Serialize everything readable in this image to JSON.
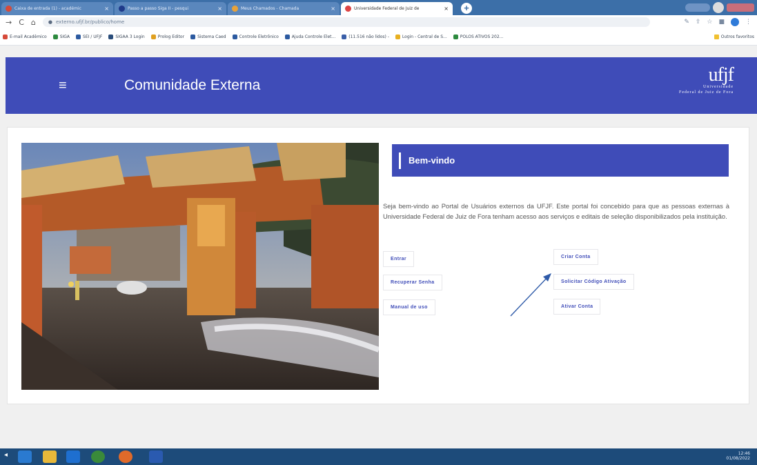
{
  "browser": {
    "tabs": [
      {
        "label": "Caixa de entrada (1) - académic"
      },
      {
        "label": "Passo a passo Siga II - pesqui"
      },
      {
        "label": "Meus Chamados - Chamada"
      },
      {
        "label": "Universidade Federal de Juiz de"
      }
    ],
    "url": "externo.ufjf.br/publico/home",
    "bookmarks": [
      "E-mail Acadêmico",
      "SIGA",
      "SEI / UFJF",
      "SIGAA 3 Login",
      "Prolog Editor",
      "Sistema Caed",
      "Controle Eletrônico",
      "Ajuda Controle Elet...",
      "(11.516 não lidos) -",
      "Login - Central de S...",
      "POLOS ATIVOS 202..."
    ],
    "bookmarks_other": "Outros favoritos"
  },
  "header": {
    "menu_icon": "≡",
    "title": "Comunidade Externa",
    "logo_mark": "ufjf",
    "logo_sub1": "Universidade",
    "logo_sub2": "Federal de Juiz de Fora"
  },
  "welcome": {
    "heading": "Bem-vindo",
    "body": "Seja bem-vindo ao Portal de Usuários externos da UFJF. Este portal foi concebido para que as pessoas externas à Universidade Federal de Juiz de Fora tenham acesso aos serviços e editais de seleção disponibilizados pela instituição."
  },
  "actions": {
    "entrar": "Entrar",
    "criar_conta": "Criar Conta",
    "recuperar_senha": "Recuperar Senha",
    "solicitar_codigo": "Solicitar Código Ativação",
    "manual": "Manual de uso",
    "ativar_conta": "Ativar Conta"
  },
  "colors": {
    "brand": "#3f4cb8",
    "arrow": "#2e5aa8"
  },
  "taskbar": {
    "time": "12:46",
    "date": "01/08/2022"
  }
}
